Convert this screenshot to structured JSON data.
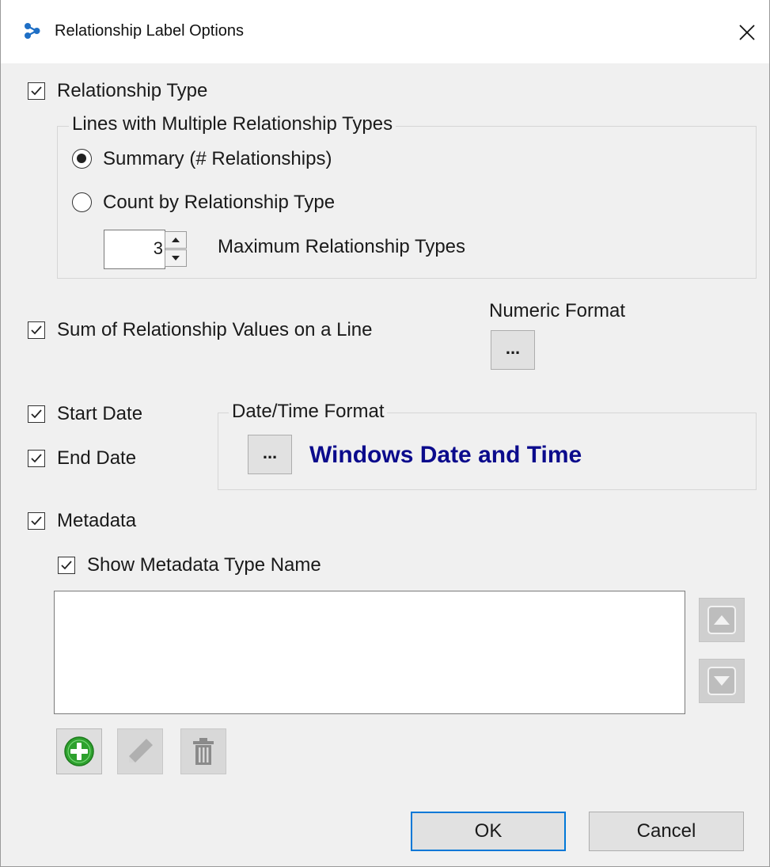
{
  "window": {
    "title": "Relationship Label Options",
    "app_icon": "relationship-graph-icon",
    "close_icon": "close-icon"
  },
  "relationship_type": {
    "label": "Relationship Type",
    "checked": true,
    "group_label": "Lines with Multiple Relationship Types",
    "options": [
      {
        "label": "Summary (# Relationships)",
        "selected": true
      },
      {
        "label": "Count by Relationship Type",
        "selected": false
      }
    ],
    "max_types_value": "3",
    "max_types_label": "Maximum Relationship Types"
  },
  "sum_values": {
    "label": "Sum of Relationship Values on a Line",
    "checked": true,
    "numeric_format_label": "Numeric Format",
    "numeric_format_button": "..."
  },
  "dates": {
    "start_label": "Start Date",
    "start_checked": true,
    "end_label": "End Date",
    "end_checked": true,
    "format_group_label": "Date/Time Format",
    "format_button": "...",
    "format_value": "Windows Date and Time",
    "format_value_color": "#0b0b8c"
  },
  "metadata": {
    "label": "Metadata",
    "checked": true,
    "show_type_name_label": "Show Metadata Type Name",
    "show_type_name_checked": true,
    "items": [],
    "move_up_icon": "arrow-up-icon",
    "move_down_icon": "arrow-down-icon",
    "add_icon": "add-circle-icon",
    "edit_icon": "pencil-icon",
    "delete_icon": "trash-icon"
  },
  "buttons": {
    "ok": "OK",
    "cancel": "Cancel"
  }
}
